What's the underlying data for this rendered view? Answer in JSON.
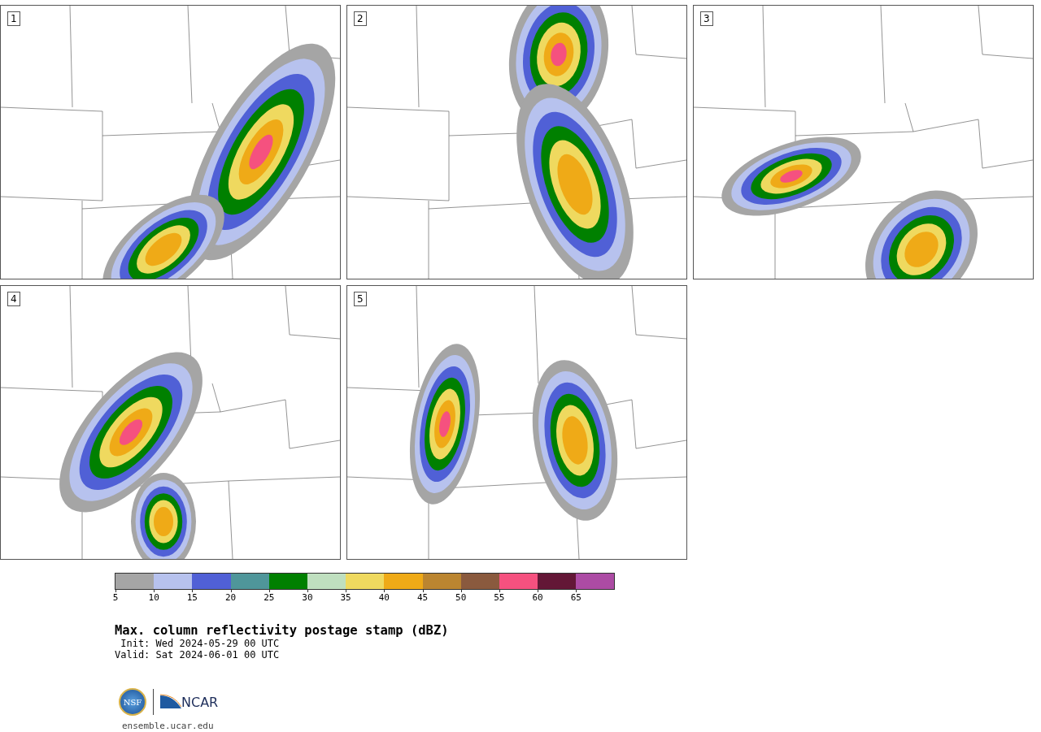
{
  "panels": [
    {
      "number": "1"
    },
    {
      "number": "2"
    },
    {
      "number": "3"
    },
    {
      "number": "4"
    },
    {
      "number": "5"
    }
  ],
  "colorbar": {
    "bins": [
      {
        "color": "#a5a5a5"
      },
      {
        "color": "#b7c2ee"
      },
      {
        "color": "#5060d6"
      },
      {
        "color": "#4f969a"
      },
      {
        "color": "#008000"
      },
      {
        "color": "#bfdfbf"
      },
      {
        "color": "#efd95f"
      },
      {
        "color": "#efaa17"
      },
      {
        "color": "#bb8530"
      },
      {
        "color": "#8a5a3e"
      },
      {
        "color": "#f5517f"
      },
      {
        "color": "#631736"
      },
      {
        "color": "#ac4ba4"
      }
    ],
    "ticks": [
      "5",
      "10",
      "15",
      "20",
      "25",
      "30",
      "35",
      "40",
      "45",
      "50",
      "55",
      "60",
      "65"
    ]
  },
  "title": "Max. column reflectivity postage stamp (dBZ)",
  "init": " Init: Wed 2024-05-29 00 UTC",
  "valid": "Valid: Sat 2024-06-01 00 UTC",
  "logos": {
    "left": "NSF",
    "right": "NCAR"
  },
  "url": "ensemble.ucar.edu"
}
